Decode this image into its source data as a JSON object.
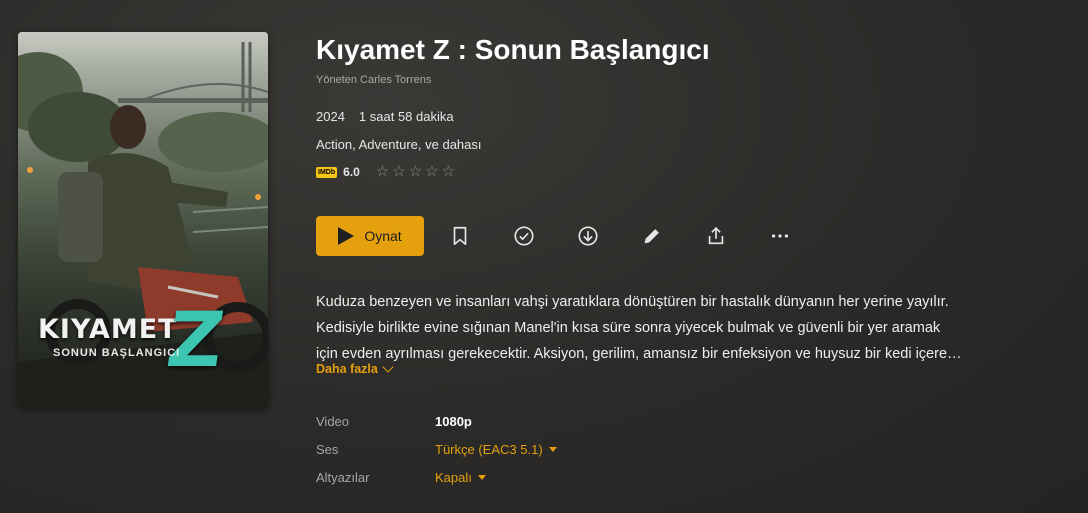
{
  "movie": {
    "title": "Kıyamet Z : Sonun Başlangıcı",
    "director": "Yöneten Carles Torrens",
    "year": "2024",
    "duration": "1 saat 58 dakika",
    "genres": "Action, Adventure, ve dahası",
    "imdb_badge": "IMDb",
    "imdb_score": "6.0",
    "user_rating_stars": 0,
    "star_glyph": "☆"
  },
  "poster": {
    "title_text": "KIYAMET",
    "z_text": "Z",
    "subtitle_text": "SONUN BAŞLANGICI"
  },
  "actions": {
    "play_label": "Oynat",
    "icons": [
      "bookmark-icon",
      "check-circle-icon",
      "download-icon",
      "pencil-icon",
      "share-icon",
      "more-icon"
    ]
  },
  "description": {
    "lines": [
      "Kuduza benzeyen ve insanları vahşi yaratıklara dönüştüren bir hastalık dünyanın her yerine yayılır.",
      "Kedisiyle birlikte evine sığınan Manel'in kısa süre sonra yiyecek bulmak ve güvenli bir yer aramak",
      "için evden ayrılması gerekecektir. Aksiyon, gerilim, amansız bir enfeksiyon ve huysuz bir kedi içere…"
    ],
    "more_label": "Daha fazla"
  },
  "specs": {
    "video_label": "Video",
    "video_value": "1080p",
    "audio_label": "Ses",
    "audio_value": "Türkçe (EAC3 5.1)",
    "subtitles_label": "Altyazılar",
    "subtitles_value": "Kapalı"
  },
  "colors": {
    "accent": "#e5a00d",
    "background": "#2b2a28",
    "imdb": "#f5c518",
    "poster_z": "#3cc6b2"
  }
}
